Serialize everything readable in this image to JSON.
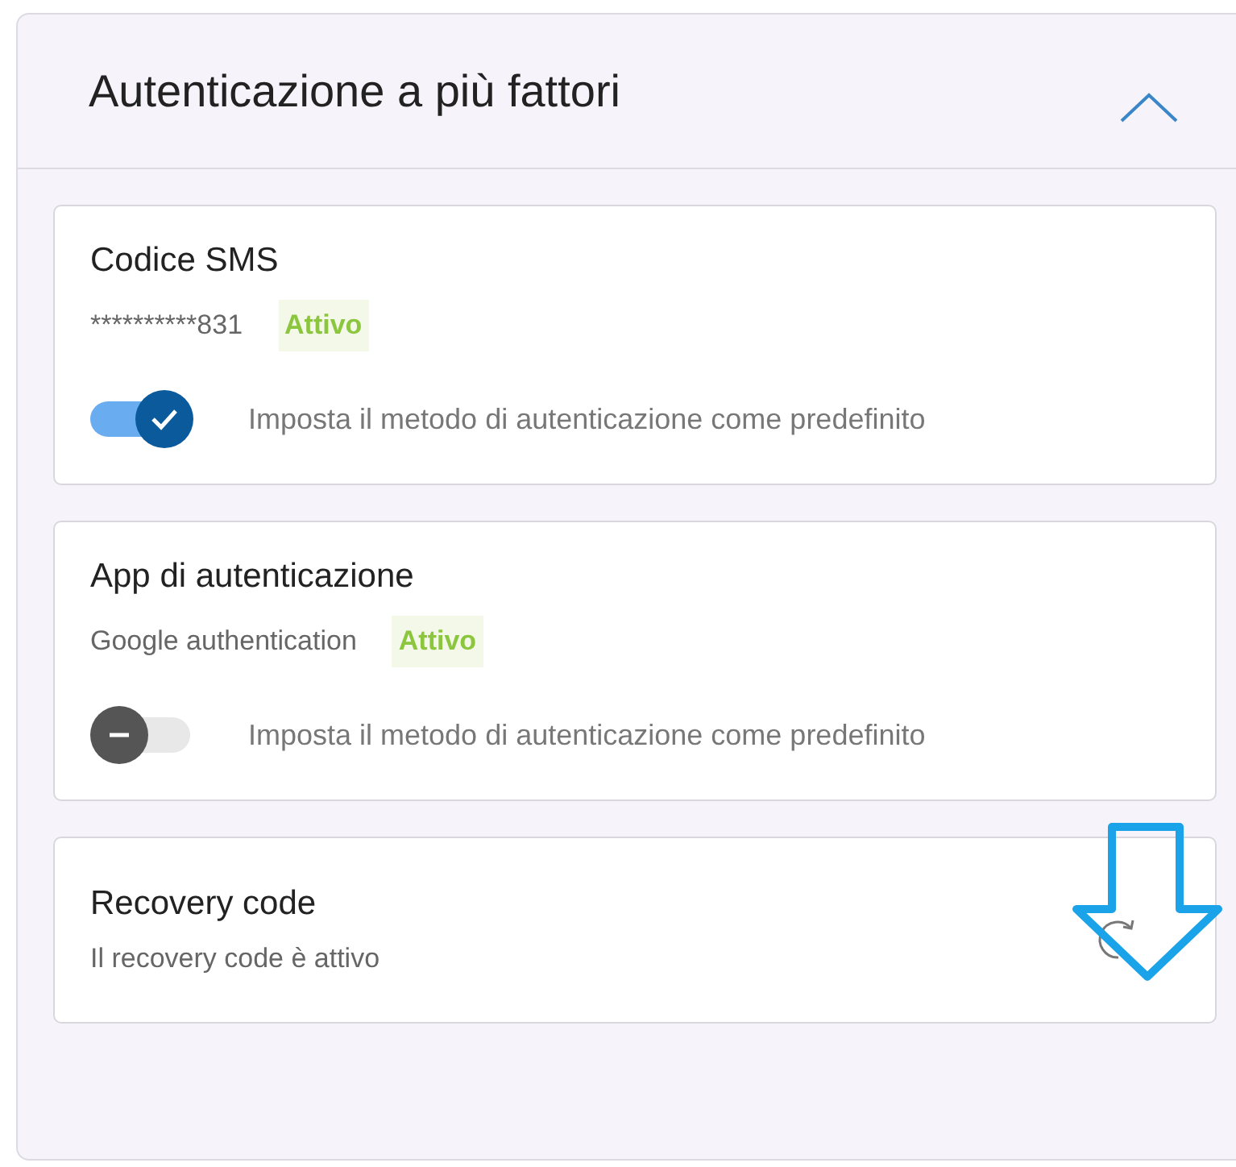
{
  "panel": {
    "title": "Autenticazione a più fattori",
    "expanded": true
  },
  "methods": [
    {
      "kind": "toggle",
      "title": "Codice SMS",
      "detail": "**********831",
      "status": "Attivo",
      "default_on": true,
      "toggle_label": "Imposta il metodo di autenticazione come predefinito"
    },
    {
      "kind": "toggle",
      "title": "App di autenticazione",
      "detail": "Google authentication",
      "status": "Attivo",
      "default_on": false,
      "toggle_label": "Imposta il metodo di autenticazione come predefinito"
    },
    {
      "kind": "refresh",
      "title": "Recovery code",
      "detail": "Il recovery code è attivo"
    }
  ]
}
